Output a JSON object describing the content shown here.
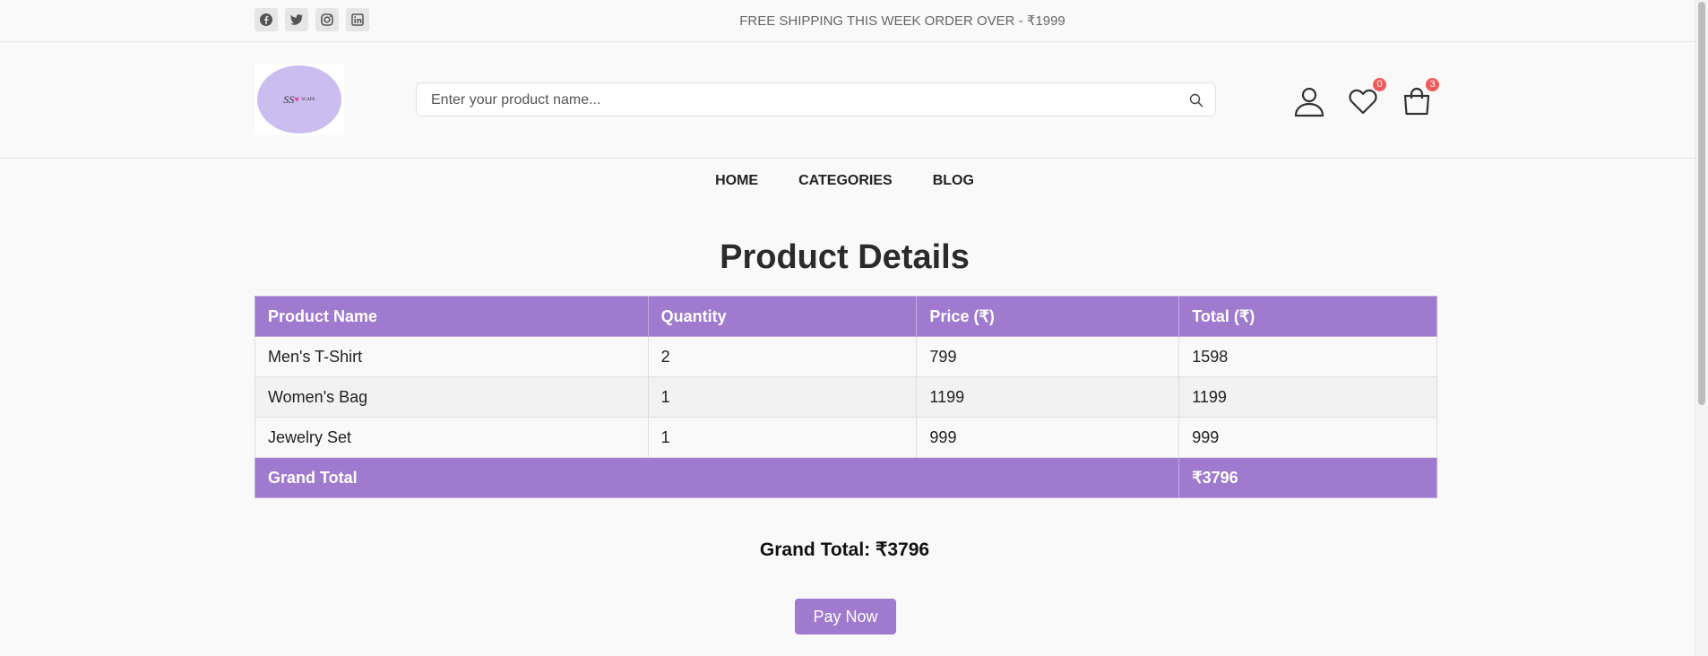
{
  "topbar": {
    "socials": [
      {
        "icon": "facebook-icon"
      },
      {
        "icon": "twitter-icon"
      },
      {
        "icon": "instagram-icon"
      },
      {
        "icon": "linkedin-icon"
      }
    ],
    "shipping_text": "FREE SHIPPING THIS WEEK ORDER OVER - ₹1999"
  },
  "header": {
    "search": {
      "placeholder": "Enter your product name..."
    },
    "wishlist_count": "0",
    "cart_count": "3"
  },
  "nav": {
    "items": [
      "HOME",
      "CATEGORIES",
      "BLOG"
    ]
  },
  "main": {
    "title": "Product Details",
    "table": {
      "headers": [
        "Product Name",
        "Quantity",
        "Price (₹)",
        "Total (₹)"
      ],
      "rows": [
        [
          "Men's T-Shirt",
          "2",
          "799",
          "1598"
        ],
        [
          "Women's Bag",
          "1",
          "1199",
          "1199"
        ],
        [
          "Jewelry Set",
          "1",
          "999",
          "999"
        ]
      ],
      "footer": {
        "label": "Grand Total",
        "value": "₹3796"
      }
    },
    "summary": "Grand Total: ₹3796",
    "pay_label": "Pay Now"
  },
  "colors": {
    "accent": "#9f7acf",
    "badge": "#f25a5a",
    "logo_bg": "#cbbdf0"
  }
}
